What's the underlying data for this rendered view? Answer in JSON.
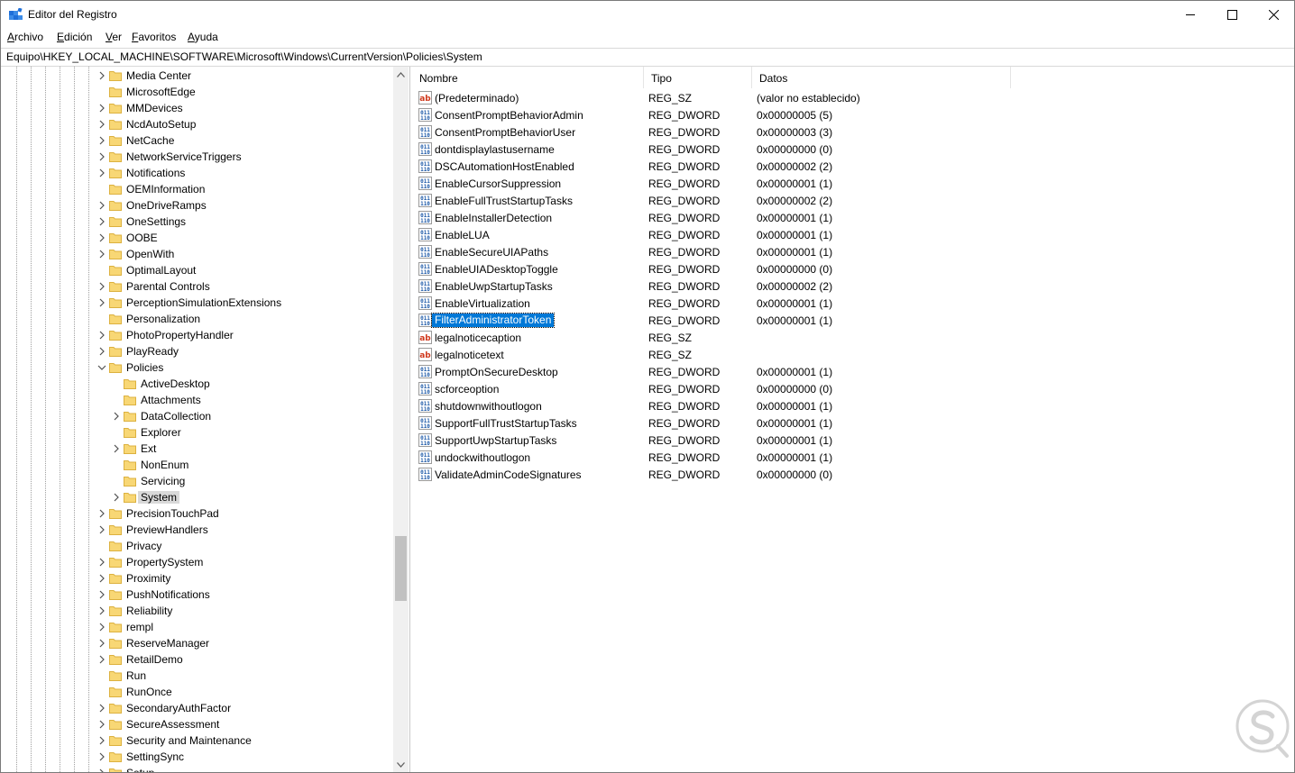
{
  "window": {
    "title": "Editor del Registro"
  },
  "menu": [
    {
      "label": "Archivo",
      "accel": "A",
      "rest": "rchivo"
    },
    {
      "label": "Edición",
      "accel": "E",
      "rest": "dición"
    },
    {
      "label": "Ver",
      "accel": "V",
      "rest": "er"
    },
    {
      "label": "Favoritos",
      "accel": "F",
      "rest": "avoritos"
    },
    {
      "label": "Ayuda",
      "accel": "A",
      "rest": "yuda"
    }
  ],
  "address": "Equipo\\HKEY_LOCAL_MACHINE\\SOFTWARE\\Microsoft\\Windows\\CurrentVersion\\Policies\\System",
  "tree": [
    {
      "label": "Media Center",
      "chevron": "right",
      "level": 0
    },
    {
      "label": "MicrosoftEdge",
      "chevron": "none",
      "level": 0
    },
    {
      "label": "MMDevices",
      "chevron": "right",
      "level": 0
    },
    {
      "label": "NcdAutoSetup",
      "chevron": "right",
      "level": 0
    },
    {
      "label": "NetCache",
      "chevron": "right",
      "level": 0
    },
    {
      "label": "NetworkServiceTriggers",
      "chevron": "right",
      "level": 0
    },
    {
      "label": "Notifications",
      "chevron": "right",
      "level": 0
    },
    {
      "label": "OEMInformation",
      "chevron": "none",
      "level": 0
    },
    {
      "label": "OneDriveRamps",
      "chevron": "right",
      "level": 0
    },
    {
      "label": "OneSettings",
      "chevron": "right",
      "level": 0
    },
    {
      "label": "OOBE",
      "chevron": "right",
      "level": 0
    },
    {
      "label": "OpenWith",
      "chevron": "right",
      "level": 0
    },
    {
      "label": "OptimalLayout",
      "chevron": "none",
      "level": 0
    },
    {
      "label": "Parental Controls",
      "chevron": "right",
      "level": 0
    },
    {
      "label": "PerceptionSimulationExtensions",
      "chevron": "right",
      "level": 0
    },
    {
      "label": "Personalization",
      "chevron": "none",
      "level": 0
    },
    {
      "label": "PhotoPropertyHandler",
      "chevron": "right",
      "level": 0
    },
    {
      "label": "PlayReady",
      "chevron": "right",
      "level": 0
    },
    {
      "label": "Policies",
      "chevron": "down",
      "level": 0
    },
    {
      "label": "ActiveDesktop",
      "chevron": "none",
      "level": 1
    },
    {
      "label": "Attachments",
      "chevron": "none",
      "level": 1
    },
    {
      "label": "DataCollection",
      "chevron": "right",
      "level": 1
    },
    {
      "label": "Explorer",
      "chevron": "none",
      "level": 1
    },
    {
      "label": "Ext",
      "chevron": "right",
      "level": 1
    },
    {
      "label": "NonEnum",
      "chevron": "none",
      "level": 1
    },
    {
      "label": "Servicing",
      "chevron": "none",
      "level": 1
    },
    {
      "label": "System",
      "chevron": "right",
      "level": 1,
      "selected": true
    },
    {
      "label": "PrecisionTouchPad",
      "chevron": "right",
      "level": 0
    },
    {
      "label": "PreviewHandlers",
      "chevron": "right",
      "level": 0
    },
    {
      "label": "Privacy",
      "chevron": "none",
      "level": 0
    },
    {
      "label": "PropertySystem",
      "chevron": "right",
      "level": 0
    },
    {
      "label": "Proximity",
      "chevron": "right",
      "level": 0
    },
    {
      "label": "PushNotifications",
      "chevron": "right",
      "level": 0
    },
    {
      "label": "Reliability",
      "chevron": "right",
      "level": 0
    },
    {
      "label": "rempl",
      "chevron": "right",
      "level": 0
    },
    {
      "label": "ReserveManager",
      "chevron": "right",
      "level": 0
    },
    {
      "label": "RetailDemo",
      "chevron": "right",
      "level": 0
    },
    {
      "label": "Run",
      "chevron": "none",
      "level": 0
    },
    {
      "label": "RunOnce",
      "chevron": "none",
      "level": 0
    },
    {
      "label": "SecondaryAuthFactor",
      "chevron": "right",
      "level": 0
    },
    {
      "label": "SecureAssessment",
      "chevron": "right",
      "level": 0
    },
    {
      "label": "Security and Maintenance",
      "chevron": "right",
      "level": 0
    },
    {
      "label": "SettingSync",
      "chevron": "right",
      "level": 0
    },
    {
      "label": "Setup",
      "chevron": "right",
      "level": 0
    }
  ],
  "columns": [
    "Nombre",
    "Tipo",
    "Datos"
  ],
  "values": [
    {
      "name": "(Predeterminado)",
      "type": "REG_SZ",
      "data": "(valor no establecido)",
      "icon": "string-value-icon"
    },
    {
      "name": "ConsentPromptBehaviorAdmin",
      "type": "REG_DWORD",
      "data": "0x00000005 (5)",
      "icon": "dword-value-icon"
    },
    {
      "name": "ConsentPromptBehaviorUser",
      "type": "REG_DWORD",
      "data": "0x00000003 (3)",
      "icon": "dword-value-icon"
    },
    {
      "name": "dontdisplaylastusername",
      "type": "REG_DWORD",
      "data": "0x00000000 (0)",
      "icon": "dword-value-icon"
    },
    {
      "name": "DSCAutomationHostEnabled",
      "type": "REG_DWORD",
      "data": "0x00000002 (2)",
      "icon": "dword-value-icon"
    },
    {
      "name": "EnableCursorSuppression",
      "type": "REG_DWORD",
      "data": "0x00000001 (1)",
      "icon": "dword-value-icon"
    },
    {
      "name": "EnableFullTrustStartupTasks",
      "type": "REG_DWORD",
      "data": "0x00000002 (2)",
      "icon": "dword-value-icon"
    },
    {
      "name": "EnableInstallerDetection",
      "type": "REG_DWORD",
      "data": "0x00000001 (1)",
      "icon": "dword-value-icon"
    },
    {
      "name": "EnableLUA",
      "type": "REG_DWORD",
      "data": "0x00000001 (1)",
      "icon": "dword-value-icon"
    },
    {
      "name": "EnableSecureUIAPaths",
      "type": "REG_DWORD",
      "data": "0x00000001 (1)",
      "icon": "dword-value-icon"
    },
    {
      "name": "EnableUIADesktopToggle",
      "type": "REG_DWORD",
      "data": "0x00000000 (0)",
      "icon": "dword-value-icon"
    },
    {
      "name": "EnableUwpStartupTasks",
      "type": "REG_DWORD",
      "data": "0x00000002 (2)",
      "icon": "dword-value-icon"
    },
    {
      "name": "EnableVirtualization",
      "type": "REG_DWORD",
      "data": "0x00000001 (1)",
      "icon": "dword-value-icon"
    },
    {
      "name": "FilterAdministratorToken",
      "type": "REG_DWORD",
      "data": "0x00000001 (1)",
      "icon": "dword-value-icon",
      "selected": true
    },
    {
      "name": "legalnoticecaption",
      "type": "REG_SZ",
      "data": "",
      "icon": "string-value-icon"
    },
    {
      "name": "legalnoticetext",
      "type": "REG_SZ",
      "data": "",
      "icon": "string-value-icon"
    },
    {
      "name": "PromptOnSecureDesktop",
      "type": "REG_DWORD",
      "data": "0x00000001 (1)",
      "icon": "dword-value-icon"
    },
    {
      "name": "scforceoption",
      "type": "REG_DWORD",
      "data": "0x00000000 (0)",
      "icon": "dword-value-icon"
    },
    {
      "name": "shutdownwithoutlogon",
      "type": "REG_DWORD",
      "data": "0x00000001 (1)",
      "icon": "dword-value-icon"
    },
    {
      "name": "SupportFullTrustStartupTasks",
      "type": "REG_DWORD",
      "data": "0x00000001 (1)",
      "icon": "dword-value-icon"
    },
    {
      "name": "SupportUwpStartupTasks",
      "type": "REG_DWORD",
      "data": "0x00000001 (1)",
      "icon": "dword-value-icon"
    },
    {
      "name": "undockwithoutlogon",
      "type": "REG_DWORD",
      "data": "0x00000001 (1)",
      "icon": "dword-value-icon"
    },
    {
      "name": "ValidateAdminCodeSignatures",
      "type": "REG_DWORD",
      "data": "0x00000000 (0)",
      "icon": "dword-value-icon"
    }
  ],
  "colors": {
    "selection": "#0078d7",
    "folder": "#f8d775",
    "folder_edge": "#dcb13f",
    "string_icon": "#d03a1e",
    "dword_icon": "#1e5aa8"
  }
}
